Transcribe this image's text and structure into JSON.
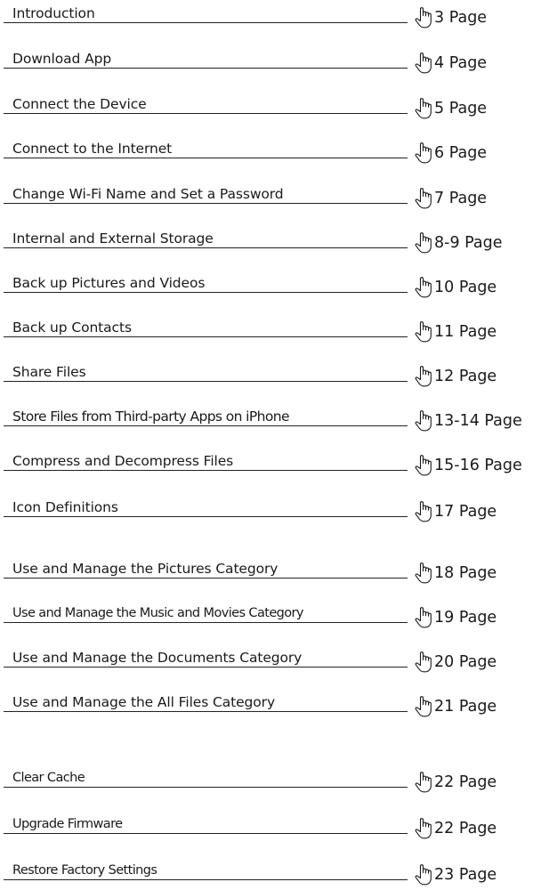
{
  "toc": {
    "items": [
      {
        "title": "Introduction",
        "page": "3 Page"
      },
      {
        "title": "Download App",
        "page": "4 Page"
      },
      {
        "title": "Connect the Device",
        "page": "5 Page"
      },
      {
        "title": "Connect to the Internet",
        "page": "6 Page"
      },
      {
        "title": "Change Wi-Fi Name and Set a Password",
        "page": "7 Page"
      },
      {
        "title": "Internal and External Storage",
        "page": "8-9 Page"
      },
      {
        "title": "Back up Pictures and Videos",
        "page": "10 Page"
      },
      {
        "title": "Back up Contacts",
        "page": "11 Page"
      },
      {
        "title": "Share Files",
        "page": "12 Page"
      },
      {
        "title": "Store Files from Third-party Apps on iPhone",
        "page": "13-14 Page"
      },
      {
        "title": "Compress and Decompress Files",
        "page": "15-16 Page"
      },
      {
        "title": "Icon Definitions",
        "page": "17 Page"
      },
      {
        "title": "Use and Manage the Pictures Category",
        "page": "18 Page"
      },
      {
        "title": "Use and Manage the Music and Movies Category",
        "page": "19 Page"
      },
      {
        "title": "Use and Manage the Documents Category",
        "page": "20 Page"
      },
      {
        "title": "Use and Manage the All Files Category",
        "page": "21 Page"
      },
      {
        "title": "Clear Cache",
        "page": "22 Page"
      },
      {
        "title": "Upgrade Firmware",
        "page": "22 Page"
      },
      {
        "title": "Restore Factory Settings",
        "page": "23 Page"
      }
    ],
    "pointer_icon": "pointing-hand-icon"
  }
}
